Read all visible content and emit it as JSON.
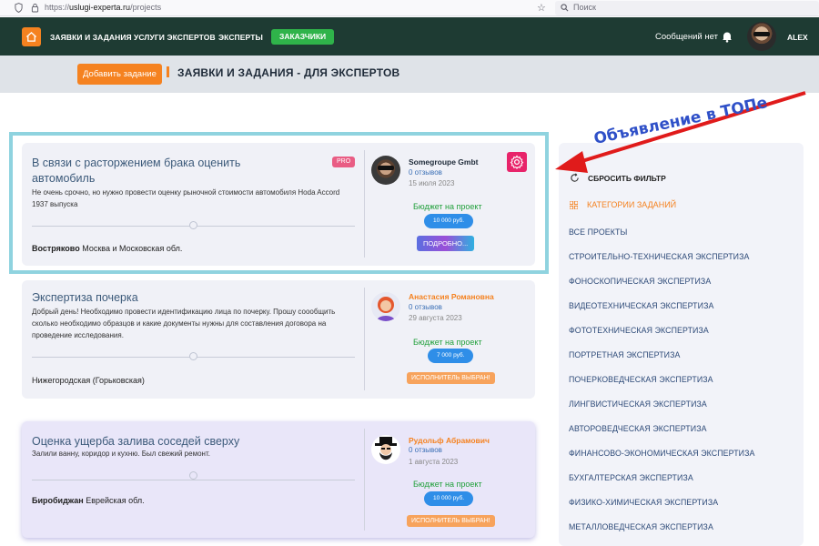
{
  "browser": {
    "url_host": "https://",
    "url_domain": "uslugi-experta.ru",
    "url_path": "/projects",
    "search_placeholder": "Поиск",
    "star": "☆"
  },
  "nav": {
    "items": [
      "ЗАЯВКИ И ЗАДАНИЯ",
      "УСЛУГИ ЭКСПЕРТОВ",
      "ЭКСПЕРТЫ"
    ],
    "active_item": "ЗАКАЗЧИКИ",
    "messages": "Сообщений нет",
    "user": "ALEX"
  },
  "subheader": {
    "add_button": "Добавить задание",
    "title": "ЗАЯВКИ И ЗАДАНИЯ - ДЛЯ ЭКСПЕРТОВ"
  },
  "annotation": {
    "text": "Объявление в ТОПе",
    "color": "#2f50c8"
  },
  "cards": [
    {
      "title_line1": "В связи с расторжением брака оценить",
      "title_line2": "автомобиль",
      "badge": "PRO",
      "desc": "Не очень срочно, но нужно провести оценку рыночной стоимости автомобиля Hoda Accord 1937 выпуска",
      "loc_bold": "Востряково",
      "loc_rest": " Москва и Московская обл.",
      "author": "Somegroupe Gmbt",
      "author_color": "#1e2a38",
      "reviews": "0 отзывов",
      "date": "15 июля 2023",
      "budget_label": "Бюджет на проект",
      "budget": "10 000 руб.",
      "action": "ПОДРОБНО..."
    },
    {
      "title_line1": "Экспертиза почерка",
      "desc": "Добрый день! Необходимо провести идентификацию лица по почерку. Прошу соообщить сколько необходимо образцов и какие документы нужны для составления договора на проведение исследования.",
      "loc_bold": "",
      "loc_rest": "Нижегородская (Горьковская)",
      "author": "Анастасия Романовна",
      "author_color": "#f58220",
      "reviews": "0 отзывов",
      "date": "29 августа 2023",
      "budget_label": "Бюджет на проект",
      "budget": "7 000 руб.",
      "action": "ИСПОЛНИТЕЛЬ ВЫБРАН!"
    },
    {
      "title_line1": "Оценка ущерба залива соседей сверху",
      "desc": "Залили ванну, коридор и кухню. Был свежий ремонт.",
      "loc_bold": "Биробиджан",
      "loc_rest": " Еврейская обл.",
      "author": "Рудольф Абрамович",
      "author_color": "#f58220",
      "reviews": "0 отзывов",
      "date": "1 августа 2023",
      "budget_label": "Бюджет на проект",
      "budget": "10 000 руб.",
      "action": "ИСПОЛНИТЕЛЬ ВЫБРАН!"
    }
  ],
  "sidebar": {
    "reset": "СБРОСИТЬ ФИЛЬТР",
    "categories_heading": "КАТЕГОРИИ ЗАДАНИЙ",
    "items": [
      "ВСЕ ПРОЕКТЫ",
      "СТРОИТЕЛЬНО-ТЕХНИЧЕСКАЯ ЭКСПЕРТИЗА",
      "ФОНОСКОПИЧЕСКАЯ ЭКСПЕРТИЗА",
      "ВИДЕОТЕХНИЧЕСКАЯ ЭКСПЕРТИЗА",
      "ФОТОТЕХНИЧЕСКАЯ ЭКСПЕРТИЗА",
      "ПОРТРЕТНАЯ ЭКСПЕРТИЗА",
      "ПОЧЕРКОВЕДЧЕСКАЯ ЭКСПЕРТИЗА",
      "ЛИНГВИСТИЧЕСКАЯ ЭКСПЕРТИЗА",
      "АВТОРОВЕДЧЕСКАЯ ЭКСПЕРТИЗА",
      "ФИНАНСОВО-ЭКОНОМИЧЕСКАЯ ЭКСПЕРТИЗА",
      "БУХГАЛТЕРСКАЯ ЭКСПЕРТИЗА",
      "ФИЗИКО-ХИМИЧЕСКАЯ ЭКСПЕРТИЗА",
      "МЕТАЛЛОВЕДЧЕСКАЯ ЭКСПЕРТИЗА"
    ]
  },
  "colors": {
    "nav_bg": "#1e3b33",
    "accent_orange": "#f58220",
    "accent_green": "#2fb34a",
    "highlight_frame": "#8fd3df",
    "pro_badge": "#e95d84",
    "gear_button": "#e8246a"
  },
  "icons": [
    "shield-icon",
    "lock-icon",
    "star-icon",
    "search-icon",
    "home-icon",
    "bell-icon",
    "gear-icon",
    "refresh-icon",
    "grid-icon",
    "arrow-annotation"
  ]
}
